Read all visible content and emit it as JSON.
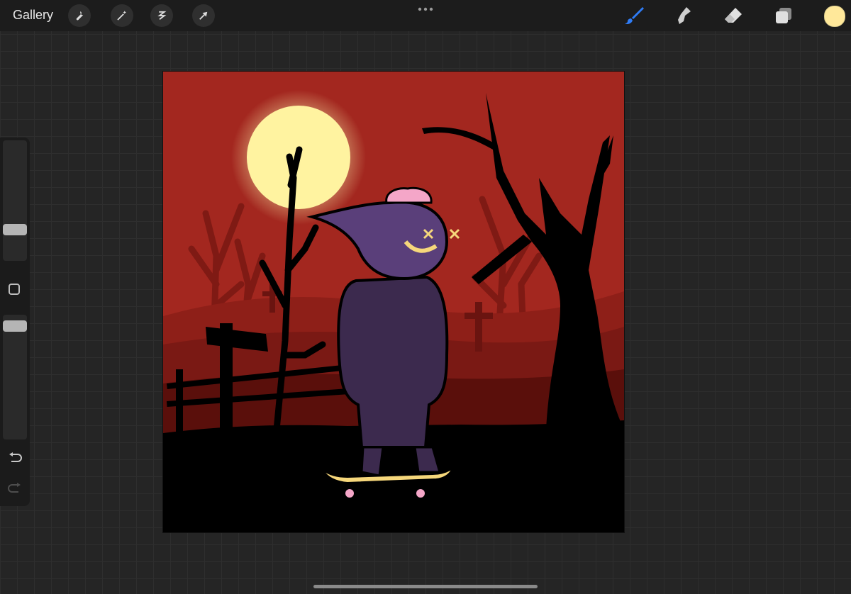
{
  "app": {
    "gallery_label": "Gallery"
  },
  "toolbar": {
    "left_tools": [
      "wrench-icon",
      "magic-wand-icon",
      "selection-icon",
      "transform-arrow-icon"
    ],
    "right_tools": [
      "brush-icon",
      "smudge-icon",
      "eraser-icon",
      "layers-icon"
    ],
    "active_tool": "brush-icon",
    "current_color": "#FFE89A",
    "accent_color": "#2F7CF6"
  },
  "sidebar": {
    "brush_size_icon": "brush-size-slider",
    "opacity_icon": "opacity-slider",
    "modify_icon": "modify-square-icon",
    "undo_icon": "undo-icon",
    "redo_icon": "redo-icon"
  },
  "artwork": {
    "description_colors": {
      "sky": "#A3271F",
      "moon": "#FFF3A0",
      "ground": "#000000",
      "robe": "#3C2A4E",
      "hood": "#5A3F7A",
      "brain": "#F4A6C8",
      "skateboard": "#F6D77B"
    }
  }
}
